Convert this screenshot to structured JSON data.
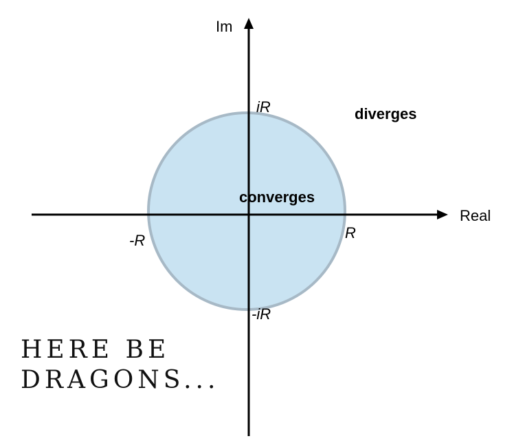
{
  "axes": {
    "x_label": "Real",
    "y_label": "Im"
  },
  "points": {
    "pos_imag": "iR",
    "neg_imag": "-iR",
    "pos_real": "R",
    "neg_real": "-R"
  },
  "regions": {
    "inside": "converges",
    "outside": "diverges"
  },
  "caption": {
    "line1": "HERE BE",
    "line2": "DRAGONS..."
  },
  "colors": {
    "disk_fill": "#c9e3f2",
    "disk_stroke": "#a7b9c6",
    "axis": "#000000"
  }
}
